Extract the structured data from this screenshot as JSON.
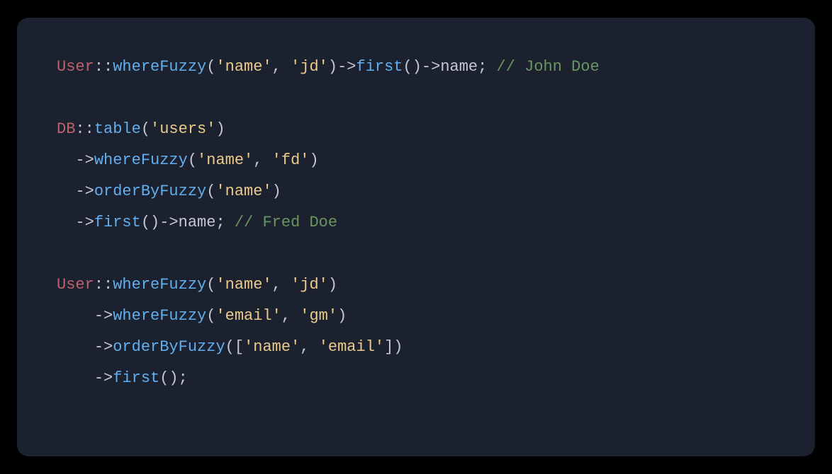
{
  "code": {
    "l1": {
      "cls": "User",
      "scope1": "::",
      "fn1": "whereFuzzy",
      "open1": "(",
      "str1": "'name'",
      "comma1": ", ",
      "str2": "'jd'",
      "close1": ")",
      "arrow1": "->",
      "fn2": "first",
      "parens2": "()",
      "arrow2": "->",
      "prop": "name",
      "semi": "; ",
      "cmt": "// John Doe"
    },
    "l2": {
      "blank": ""
    },
    "l3": {
      "cls": "DB",
      "scope": "::",
      "fn": "table",
      "open": "(",
      "str": "'users'",
      "close": ")"
    },
    "l4": {
      "indent": "  ",
      "arrow": "->",
      "fn": "whereFuzzy",
      "open": "(",
      "str1": "'name'",
      "comma": ", ",
      "str2": "'fd'",
      "close": ")"
    },
    "l5": {
      "indent": "  ",
      "arrow": "->",
      "fn": "orderByFuzzy",
      "open": "(",
      "str": "'name'",
      "close": ")"
    },
    "l6": {
      "indent": "  ",
      "arrow1": "->",
      "fn": "first",
      "parens": "()",
      "arrow2": "->",
      "prop": "name",
      "semi": "; ",
      "cmt": "// Fred Doe"
    },
    "l7": {
      "blank": ""
    },
    "l8": {
      "cls": "User",
      "scope": "::",
      "fn": "whereFuzzy",
      "open": "(",
      "str1": "'name'",
      "comma": ", ",
      "str2": "'jd'",
      "close": ")"
    },
    "l9": {
      "indent": "    ",
      "arrow": "->",
      "fn": "whereFuzzy",
      "open": "(",
      "str1": "'email'",
      "comma": ", ",
      "str2": "'gm'",
      "close": ")"
    },
    "l10": {
      "indent": "    ",
      "arrow": "->",
      "fn": "orderByFuzzy",
      "open": "([",
      "str1": "'name'",
      "comma": ", ",
      "str2": "'email'",
      "close": "])"
    },
    "l11": {
      "indent": "    ",
      "arrow": "->",
      "fn": "first",
      "parens": "()",
      "semi": ";"
    }
  }
}
